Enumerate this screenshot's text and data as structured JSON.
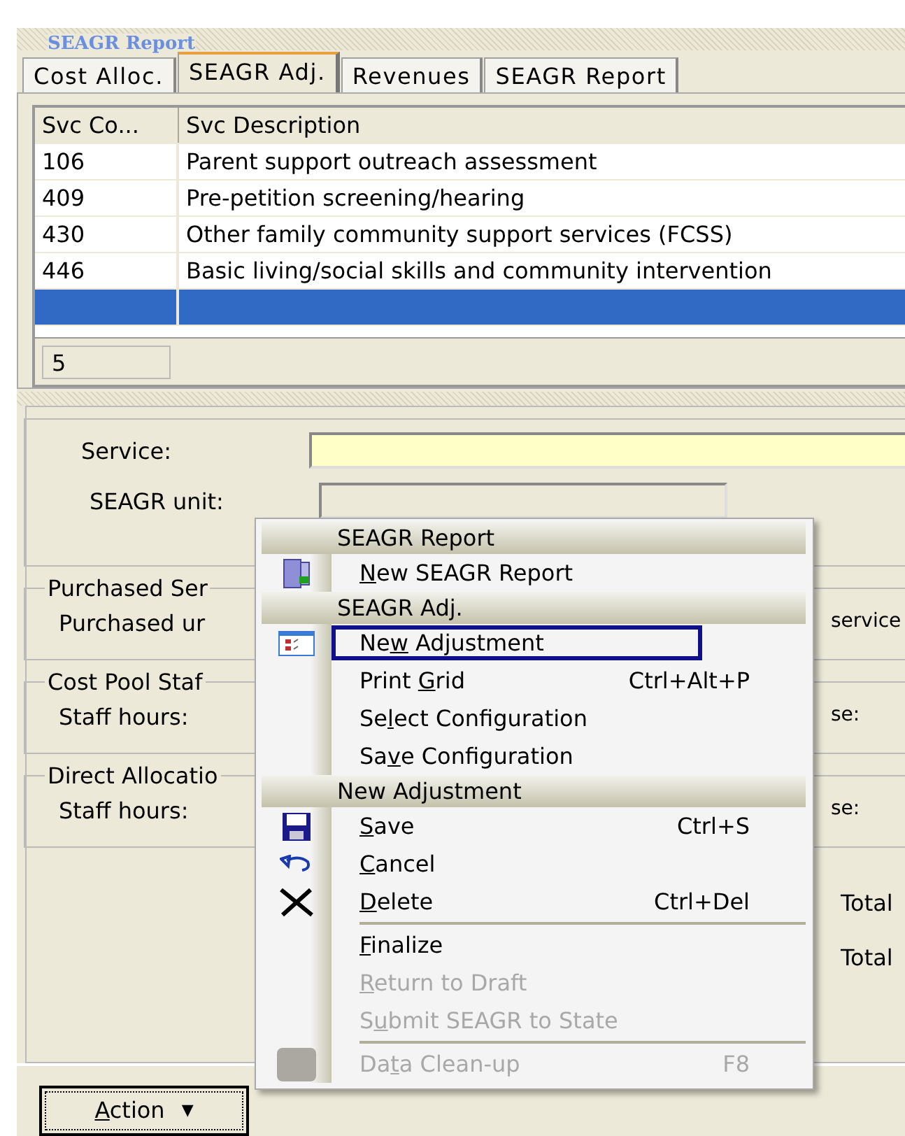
{
  "panel_title": "SEAGR Report",
  "tabs": [
    {
      "label": "Cost Alloc.",
      "selected": false
    },
    {
      "label": "SEAGR Adj.",
      "selected": true
    },
    {
      "label": "Revenues",
      "selected": false
    },
    {
      "label": "SEAGR Report",
      "selected": false
    }
  ],
  "table": {
    "columns": [
      "Svc Co...",
      "Svc Description"
    ],
    "rows": [
      {
        "code": "106",
        "description": "Parent support outreach assessment",
        "selected": false
      },
      {
        "code": "409",
        "description": "Pre-petition screening/hearing",
        "selected": false
      },
      {
        "code": "430",
        "description": "Other family community support services (FCSS)",
        "selected": false
      },
      {
        "code": "446",
        "description": "Basic living/social skills and community intervention",
        "selected": false
      },
      {
        "selected": true
      }
    ],
    "count": "5"
  },
  "form": {
    "fields": [
      {
        "label": "Service:",
        "required": true
      },
      {
        "label": "SEAGR unit:",
        "required": false
      }
    ],
    "groups": [
      {
        "title": "Purchased Ser",
        "label": "Purchased ur",
        "right": "service"
      },
      {
        "title": "Cost Pool Staf",
        "label": "Staff hours:",
        "right": "se:"
      },
      {
        "title": "Direct Allocatio",
        "label": "Staff hours:",
        "right": "se:"
      }
    ],
    "totals": [
      "Total",
      "Total"
    ]
  },
  "menu": [
    {
      "kind": "header",
      "label": "SEAGR Report"
    },
    {
      "kind": "item",
      "label": {
        "key": "N",
        "post": "ew SEAGR Report"
      },
      "disabled": false,
      "selected": false
    },
    {
      "kind": "header",
      "label": "SEAGR Adj."
    },
    {
      "kind": "item",
      "label": {
        "pre": "Ne",
        "key": "w",
        "post": " Adjustment"
      },
      "disabled": false,
      "selected": true
    },
    {
      "kind": "item",
      "label": {
        "pre": "Print ",
        "key": "G",
        "post": "rid"
      },
      "shortcut": "Ctrl+Alt+P",
      "disabled": false,
      "selected": false
    },
    {
      "kind": "item",
      "label": {
        "pre": "Se",
        "key": "l",
        "post": "ect Configuration"
      },
      "disabled": false,
      "selected": false
    },
    {
      "kind": "item",
      "label": {
        "pre": "Sa",
        "key": "v",
        "post": "e Configuration"
      },
      "disabled": false,
      "selected": false
    },
    {
      "kind": "header",
      "label": "New Adjustment"
    },
    {
      "kind": "item",
      "label": {
        "key": "S",
        "post": "ave"
      },
      "shortcut": "Ctrl+S",
      "disabled": false,
      "selected": false
    },
    {
      "kind": "item",
      "label": {
        "key": "C",
        "post": "ancel"
      },
      "disabled": false,
      "selected": false
    },
    {
      "kind": "item",
      "label": {
        "key": "D",
        "post": "elete"
      },
      "shortcut": "Ctrl+Del",
      "disabled": false,
      "selected": false
    },
    {
      "kind": "separator"
    },
    {
      "kind": "item",
      "label": {
        "key": "F",
        "post": "inalize"
      },
      "disabled": false,
      "selected": false
    },
    {
      "kind": "item",
      "label": {
        "key": "R",
        "post": "eturn to Draft"
      },
      "disabled": true,
      "selected": false
    },
    {
      "kind": "item",
      "label": {
        "pre": "S",
        "key": "u",
        "post": "bmit SEAGR to State"
      },
      "disabled": true,
      "selected": false
    },
    {
      "kind": "separator"
    },
    {
      "kind": "item",
      "label": {
        "pre": "Da",
        "key": "t",
        "post": "a Clean-up"
      },
      "shortcut": "F8",
      "disabled": true,
      "selected": false
    }
  ],
  "action_button": {
    "key": "A",
    "post": "ction",
    "arrow": "▼"
  }
}
